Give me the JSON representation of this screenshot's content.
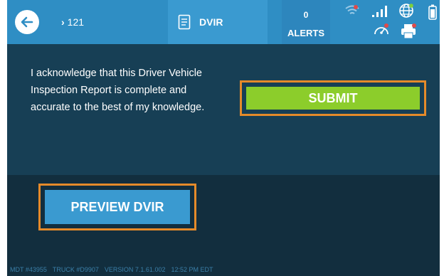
{
  "header": {
    "back_icon": "arrow-left-icon",
    "breadcrumb_icon": "chevron-right-icon",
    "breadcrumb": "121",
    "tab_icon": "document-list-icon",
    "tab_label": "DVIR",
    "alerts_count": "0",
    "alerts_label": "ALERTS",
    "status_icons": [
      "wifi-icon",
      "signal-bars-icon",
      "globe-icon",
      "battery-icon",
      "dashboard-icon",
      "printer-icon"
    ]
  },
  "main": {
    "acknowledgement": "I acknowledge that this Driver Vehicle Inspection Report is complete and accurate to the best of my knowledge.",
    "submit_label": "SUBMIT"
  },
  "actions": {
    "preview_label": "PREVIEW DVIR"
  },
  "footer": {
    "mdt": "MDT #43955",
    "truck": "TRUCK #D9907",
    "version": "VERSION  7.1.61.002",
    "time": "12:52 PM EDT"
  },
  "colors": {
    "header": "#2f8ec4",
    "main_bg": "#173f55",
    "bottom_bg": "#122e3e",
    "submit": "#8ccd2b",
    "preview": "#3a9ad0",
    "highlight": "#e58a2a"
  }
}
